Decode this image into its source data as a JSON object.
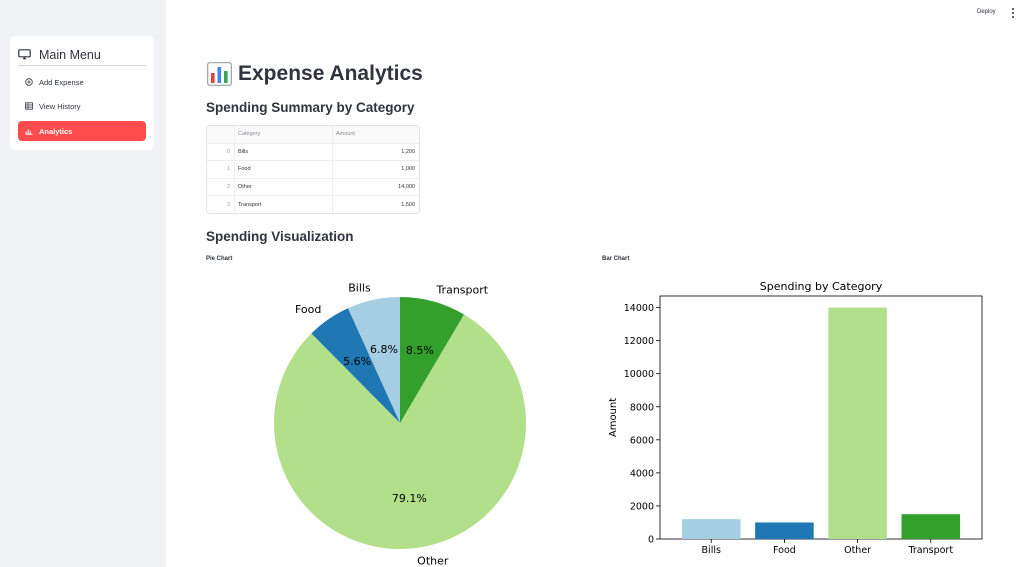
{
  "topbar": {
    "deploy_label": "Deploy"
  },
  "sidebar": {
    "menu_title": "Main Menu",
    "items": [
      {
        "label": "Add Expense",
        "icon": "plus-circle-icon"
      },
      {
        "label": "View History",
        "icon": "table-icon"
      },
      {
        "label": "Analytics",
        "icon": "bar-chart-icon",
        "active": true
      }
    ],
    "accent_color": "#ff4b4b"
  },
  "main": {
    "title": "Expense Analytics",
    "title_icon": "bar-chart-emoji-icon",
    "summary_heading": "Spending Summary by Category",
    "table": {
      "columns": [
        "",
        "Category",
        "Amount"
      ],
      "rows": [
        {
          "index": "0",
          "category": "Bills",
          "amount": "1,200"
        },
        {
          "index": "1",
          "category": "Food",
          "amount": "1,000"
        },
        {
          "index": "2",
          "category": "Other",
          "amount": "14,000"
        },
        {
          "index": "3",
          "category": "Transport",
          "amount": "1,500"
        }
      ]
    },
    "viz_heading": "Spending Visualization",
    "pie_caption": "Pie Chart",
    "bar_caption": "Bar Chart"
  },
  "chart_data": [
    {
      "type": "pie",
      "categories": [
        "Bills",
        "Food",
        "Other",
        "Transport"
      ],
      "values": [
        1200,
        1000,
        14000,
        1500
      ],
      "labels": [
        "6.8%",
        "5.6%",
        "79.1%",
        "8.5%"
      ],
      "colors": [
        "#a6cee3",
        "#1f78b4",
        "#b2df8a",
        "#33a02c"
      ],
      "title": ""
    },
    {
      "type": "bar",
      "title": "Spending by Category",
      "categories": [
        "Bills",
        "Food",
        "Other",
        "Transport"
      ],
      "values": [
        1200,
        1000,
        14000,
        1500
      ],
      "colors": [
        "#a6cee3",
        "#1f78b4",
        "#b2df8a",
        "#33a02c"
      ],
      "xlabel": "",
      "ylabel": "Amount",
      "ylim": [
        0,
        14700
      ],
      "yticks": [
        "0",
        "2000",
        "4000",
        "6000",
        "8000",
        "10000",
        "12000",
        "14000"
      ],
      "grid": false
    }
  ]
}
